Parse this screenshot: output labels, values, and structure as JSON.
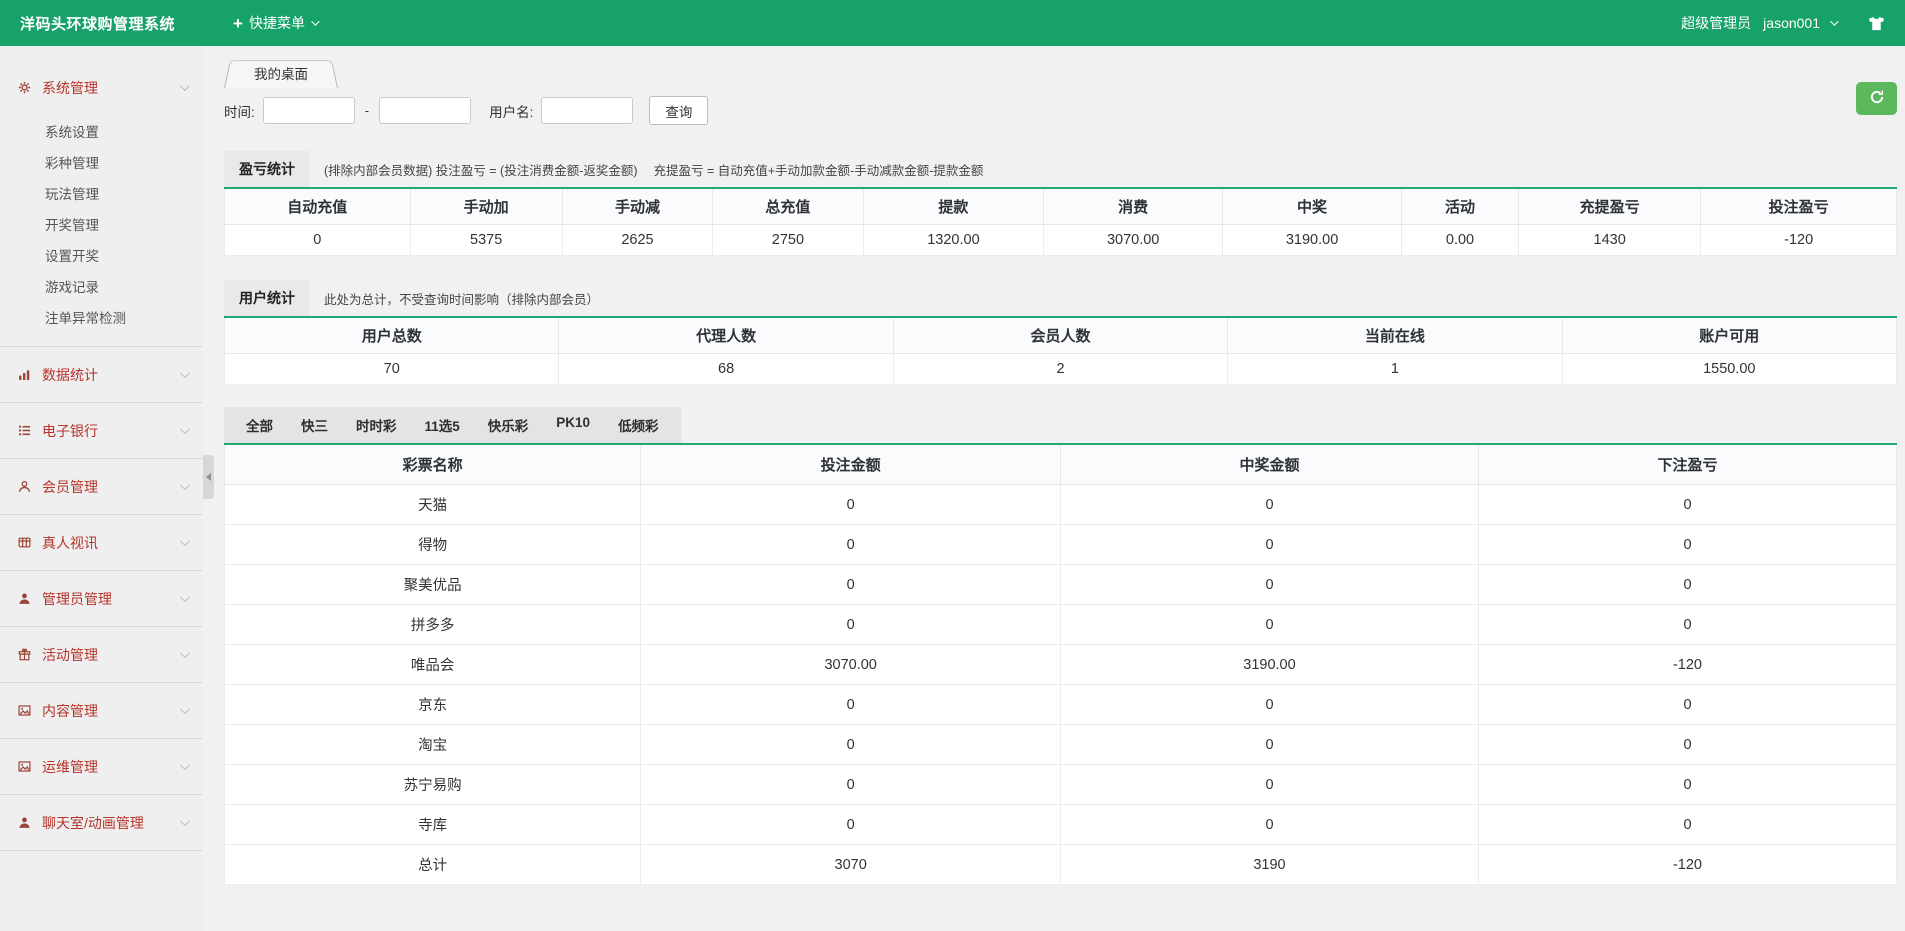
{
  "colors": {
    "brand_green": "#17a26a",
    "table_green": "#1fa971",
    "refresh_green": "#5cb85c",
    "menu_red": "#b5342c"
  },
  "header": {
    "title": "洋码头环球购管理系统",
    "quick_menu": "快捷菜单",
    "role": "超级管理员",
    "username": "jason001"
  },
  "sidebar": {
    "groups": [
      {
        "label": "系统管理",
        "icon": "gear-icon",
        "children": [
          "系统设置",
          "彩种管理",
          "玩法管理",
          "开奖管理",
          "设置开奖",
          "游戏记录",
          "注单异常检测"
        ]
      },
      {
        "label": "数据统计",
        "icon": "bar-chart-icon"
      },
      {
        "label": "电子银行",
        "icon": "list-icon"
      },
      {
        "label": "会员管理",
        "icon": "user-outline-icon"
      },
      {
        "label": "真人视讯",
        "icon": "video-icon"
      },
      {
        "label": "管理员管理",
        "icon": "admin-user-icon"
      },
      {
        "label": "活动管理",
        "icon": "gift-icon"
      },
      {
        "label": "内容管理",
        "icon": "image-icon"
      },
      {
        "label": "运维管理",
        "icon": "ops-image-icon"
      },
      {
        "label": "聊天室/动画管理",
        "icon": "chat-user-icon"
      }
    ]
  },
  "desktop_tab": "我的桌面",
  "filter": {
    "time_label": "时间:",
    "separator": "-",
    "time_from": "",
    "time_to": "",
    "username_label": "用户名:",
    "username_value": "",
    "search_button": "查询"
  },
  "profit": {
    "title": "盈亏统计",
    "note": "(排除内部会员数据) 投注盈亏 = (投注消费金额-返奖金额)　 充提盈亏 = 自动充值+手动加款金额-手动减款金额-提款金额",
    "columns": [
      "自动充值",
      "手动加",
      "手动减",
      "总充值",
      "提款",
      "消费",
      "中奖",
      "活动",
      "充提盈亏",
      "投注盈亏"
    ],
    "values": [
      "0",
      "5375",
      "2625",
      "2750",
      "1320.00",
      "3070.00",
      "3190.00",
      "0.00",
      "1430",
      "-120"
    ]
  },
  "users": {
    "title": "用户统计",
    "note": "此处为总计，不受查询时间影响（排除内部会员）",
    "columns": [
      "用户总数",
      "代理人数",
      "会员人数",
      "当前在线",
      "账户可用"
    ],
    "values": [
      "70",
      "68",
      "2",
      "1",
      "1550.00"
    ]
  },
  "lottery": {
    "tabs": [
      "全部",
      "快三",
      "时时彩",
      "11选5",
      "快乐彩",
      "PK10",
      "低频彩"
    ],
    "active_tab": "全部",
    "columns": [
      "彩票名称",
      "投注金额",
      "中奖金额",
      "下注盈亏"
    ],
    "rows": [
      [
        "天猫",
        "0",
        "0",
        "0"
      ],
      [
        "得物",
        "0",
        "0",
        "0"
      ],
      [
        "聚美优品",
        "0",
        "0",
        "0"
      ],
      [
        "拼多多",
        "0",
        "0",
        "0"
      ],
      [
        "唯品会",
        "3070.00",
        "3190.00",
        "-120"
      ],
      [
        "京东",
        "0",
        "0",
        "0"
      ],
      [
        "淘宝",
        "0",
        "0",
        "0"
      ],
      [
        "苏宁易购",
        "0",
        "0",
        "0"
      ],
      [
        "寺库",
        "0",
        "0",
        "0"
      ],
      [
        "总计",
        "3070",
        "3190",
        "-120"
      ]
    ]
  }
}
